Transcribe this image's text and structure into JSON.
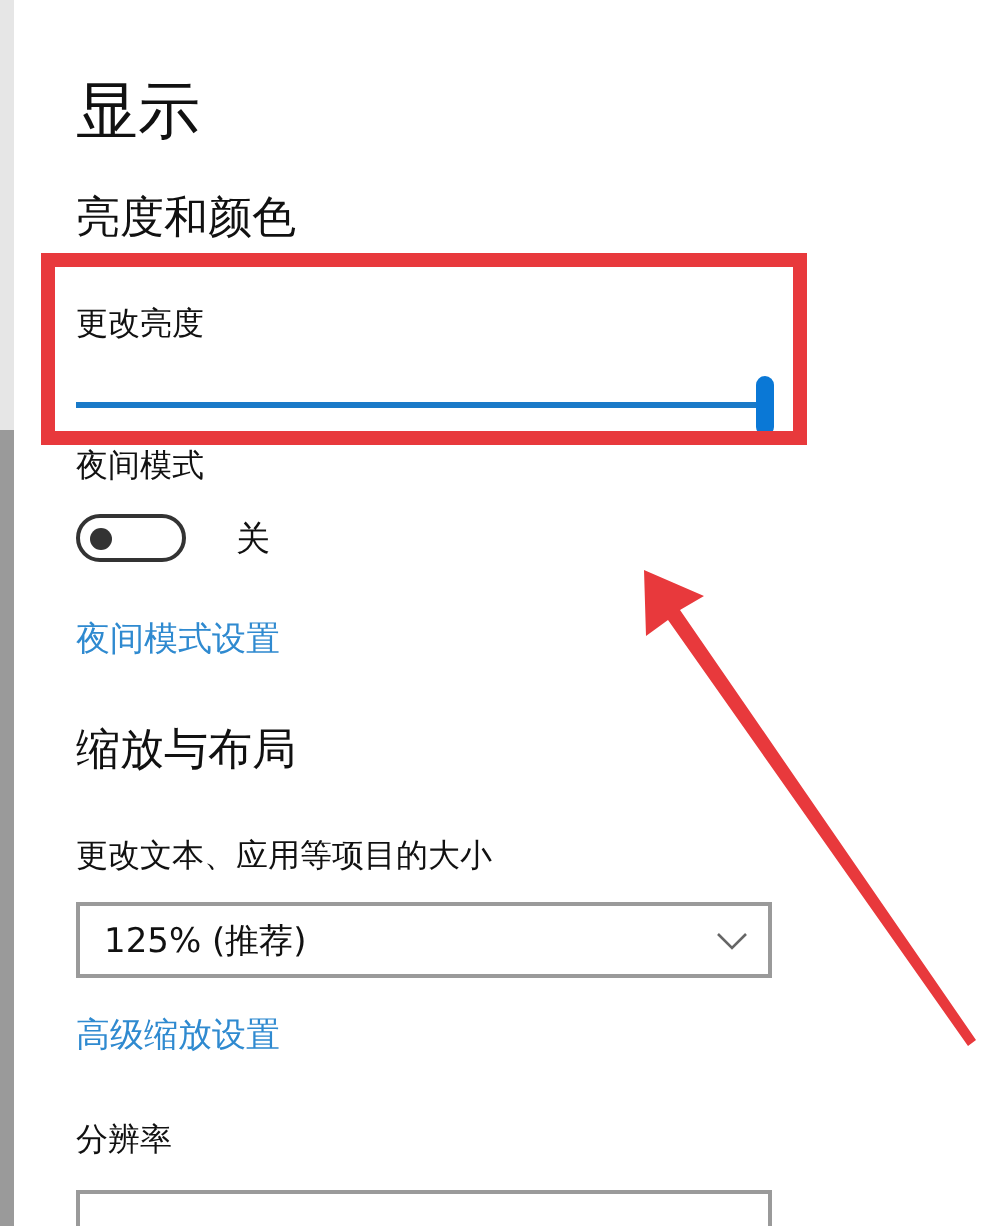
{
  "page": {
    "title": "显示"
  },
  "sections": [
    {
      "heading": "亮度和颜色",
      "items": [
        {
          "kind": "slider",
          "label": "更改亮度",
          "level": 1.0
        },
        {
          "kind": "toggle",
          "label": "夜间模式",
          "on": false,
          "state_text": "关"
        },
        {
          "kind": "link",
          "label": "夜间模式设置"
        }
      ]
    },
    {
      "heading": "缩放与布局",
      "items": [
        {
          "kind": "dropdown",
          "label": "更改文本、应用等项目的大小",
          "value": "125% (推荐)"
        },
        {
          "kind": "link",
          "label": "高级缩放设置"
        },
        {
          "kind": "dropdown",
          "label": "分辨率"
        }
      ]
    }
  ]
}
